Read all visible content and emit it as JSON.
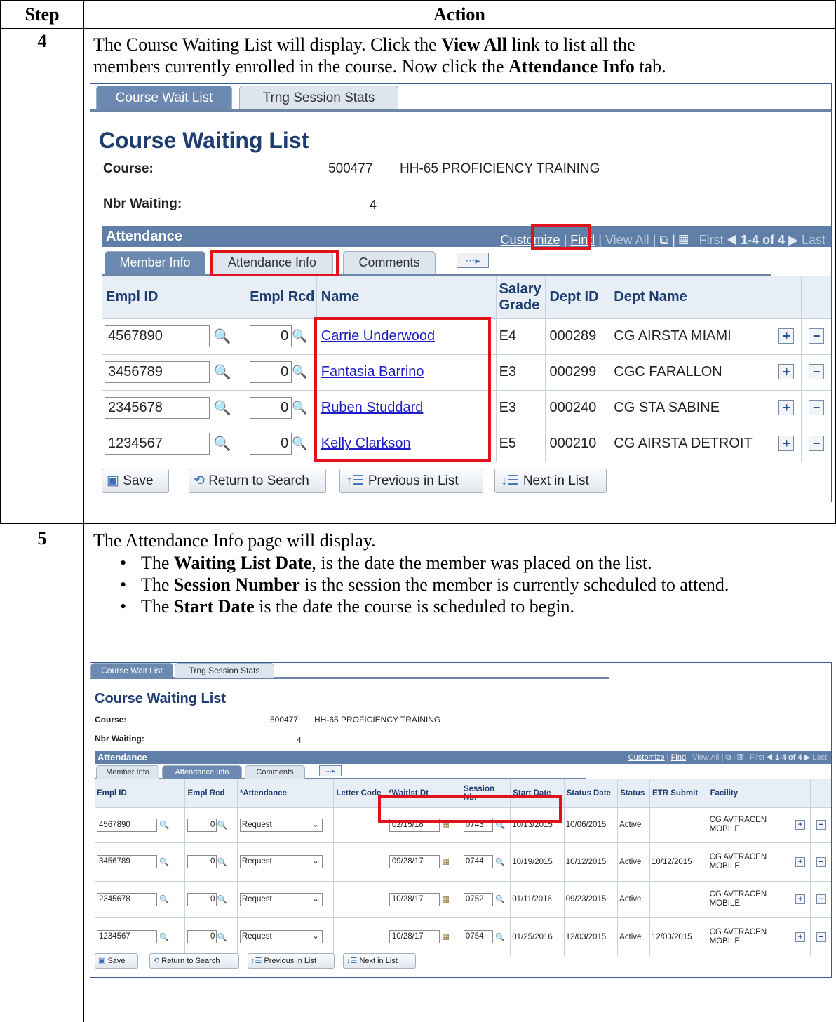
{
  "header": {
    "step": "Step",
    "action": "Action"
  },
  "step4": {
    "number": "4",
    "line1_a": "The Course Waiting List will display.  Click the ",
    "line1_b": "View All",
    "line1_c": " link to list all the",
    "line2_a": "members currently enrolled in the course.  Now click the ",
    "line2_b": "Attendance Info",
    "line2_c": " tab."
  },
  "step5": {
    "number": "5",
    "intro": "The Attendance Info page will display.",
    "bullets": [
      {
        "bold": "Waiting List Date",
        "pre": "The ",
        "post": ", is the date the member was placed on the list."
      },
      {
        "bold": "Session Number",
        "pre": "The ",
        "post": " is the session the member is currently scheduled to attend."
      },
      {
        "bold": "Start Date",
        "pre": "The ",
        "post": " is the date the course is scheduled to begin."
      }
    ]
  },
  "shot1": {
    "tabs": [
      "Course Wait List",
      "Trng Session Stats"
    ],
    "title": "Course Waiting List",
    "course_label": "Course:",
    "course_num": "500477",
    "course_name": "HH-65 PROFICIENCY TRAINING",
    "nbr_label": "Nbr Waiting:",
    "nbr_value": "4",
    "grid_title": "Attendance",
    "links": {
      "customize": "Customize",
      "find": "Find",
      "viewall": "View All",
      "first": "First",
      "range": "1-4 of 4",
      "last": "Last"
    },
    "subtabs": [
      "Member Info",
      "Attendance Info",
      "Comments"
    ],
    "columns": [
      "Empl ID",
      "Empl Rcd",
      "Name",
      "Salary Grade",
      "Dept ID",
      "Dept Name"
    ],
    "rows": [
      {
        "id": "4567890",
        "rcd": "0",
        "name": "Carrie Underwood",
        "grade": "E4",
        "dept": "000289",
        "deptname": "CG AIRSTA MIAMI"
      },
      {
        "id": "3456789",
        "rcd": "0",
        "name": "Fantasia Barrino",
        "grade": "E3",
        "dept": "000299",
        "deptname": "CGC FARALLON"
      },
      {
        "id": "2345678",
        "rcd": "0",
        "name": "Ruben Studdard",
        "grade": "E3",
        "dept": "000240",
        "deptname": "CG STA SABINE"
      },
      {
        "id": "1234567",
        "rcd": "0",
        "name": "Kelly Clarkson",
        "grade": "E5",
        "dept": "000210",
        "deptname": "CG AIRSTA DETROIT"
      }
    ],
    "buttons": [
      "Save",
      "Return to Search",
      "Previous in List",
      "Next in List"
    ]
  },
  "shot2": {
    "tabs": [
      "Course Wait List",
      "Trng Session Stats"
    ],
    "title": "Course Waiting List",
    "course_label": "Course:",
    "course_num": "500477",
    "course_name": "HH-65 PROFICIENCY TRAINING",
    "nbr_label": "Nbr Waiting:",
    "nbr_value": "4",
    "grid_title": "Attendance",
    "links": {
      "customize": "Customize",
      "find": "Find",
      "viewall": "View All",
      "first": "First",
      "range": "1-4 of 4",
      "last": "Last"
    },
    "subtabs": [
      "Member Info",
      "Attendance Info",
      "Comments"
    ],
    "columns": [
      "Empl ID",
      "Empl Rcd",
      "*Attendance",
      "Letter Code",
      "*Waitlst Dt",
      "Session Nbr",
      "Start Date",
      "Status Date",
      "Status",
      "ETR Submit",
      "Facility"
    ],
    "rows": [
      {
        "id": "4567890",
        "rcd": "0",
        "att": "Request",
        "wl": "02/15/18",
        "sess": "0743",
        "start": "10/13/2015",
        "sdate": "10/06/2015",
        "status": "Active",
        "etr": "",
        "fac": "CG AVTRACEN MOBILE"
      },
      {
        "id": "3456789",
        "rcd": "0",
        "att": "Request",
        "wl": "09/28/17",
        "sess": "0744",
        "start": "10/19/2015",
        "sdate": "10/12/2015",
        "status": "Active",
        "etr": "10/12/2015",
        "fac": "CG AVTRACEN MOBILE"
      },
      {
        "id": "2345678",
        "rcd": "0",
        "att": "Request",
        "wl": "10/28/17",
        "sess": "0752",
        "start": "01/11/2016",
        "sdate": "09/23/2015",
        "status": "Active",
        "etr": "",
        "fac": "CG AVTRACEN MOBILE"
      },
      {
        "id": "1234567",
        "rcd": "0",
        "att": "Request",
        "wl": "10/28/17",
        "sess": "0754",
        "start": "01/25/2016",
        "sdate": "12/03/2015",
        "status": "Active",
        "etr": "12/03/2015",
        "fac": "CG AVTRACEN MOBILE"
      }
    ],
    "buttons": [
      "Save",
      "Return to Search",
      "Previous in List",
      "Next in List"
    ]
  },
  "colors": {
    "accent": "#5f7fa8",
    "highlight": "#e0121a",
    "link": "#1d1dc4",
    "title": "#1d3c6f"
  },
  "icons": [
    "magnifier-icon",
    "calendar-icon",
    "plus-icon",
    "minus-icon",
    "save-icon",
    "search-return-icon",
    "previous-list-icon",
    "next-list-icon",
    "grid-options-icon",
    "zoom-icon",
    "spreadsheet-icon"
  ]
}
